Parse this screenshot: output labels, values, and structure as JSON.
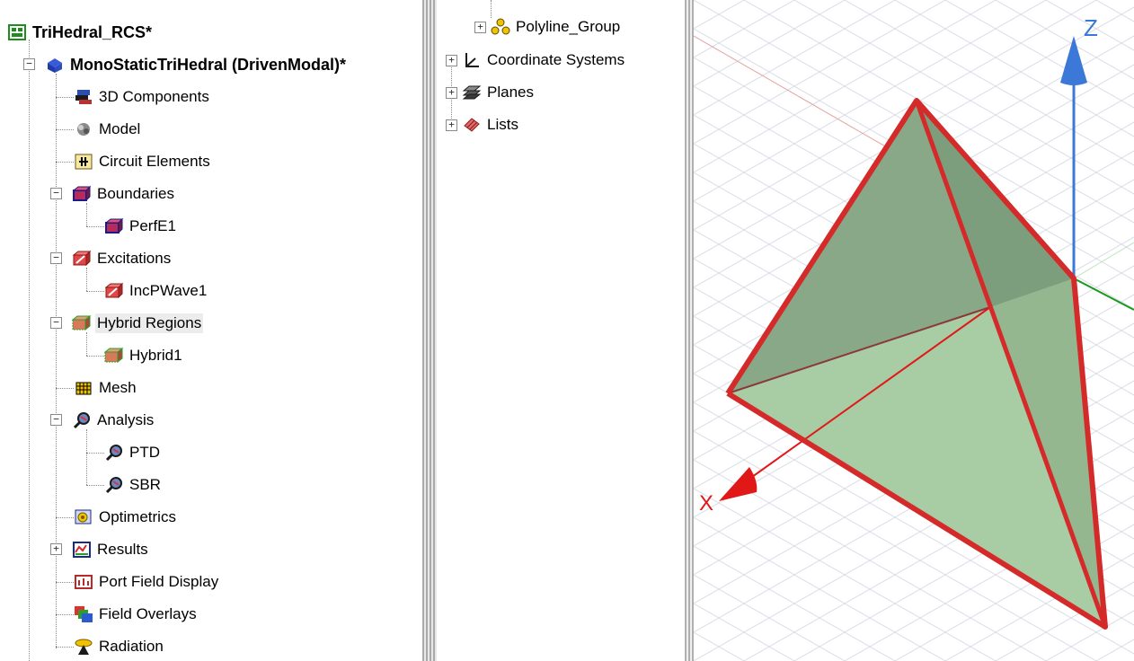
{
  "project_tree": {
    "project": "TriHedral_RCS*",
    "design": "MonoStaticTriHedral (DrivenModal)*",
    "items": [
      {
        "label": "3D Components"
      },
      {
        "label": "Model"
      },
      {
        "label": "Circuit Elements"
      },
      {
        "label": "Boundaries",
        "children": [
          "PerfE1"
        ]
      },
      {
        "label": "Excitations",
        "children": [
          "IncPWave1"
        ]
      },
      {
        "label": "Hybrid Regions",
        "children": [
          "Hybrid1"
        ]
      },
      {
        "label": "Mesh"
      },
      {
        "label": "Analysis",
        "children": [
          "PTD",
          "SBR"
        ]
      },
      {
        "label": "Optimetrics"
      },
      {
        "label": "Results"
      },
      {
        "label": "Port Field Display"
      },
      {
        "label": "Field Overlays"
      },
      {
        "label": "Radiation"
      }
    ]
  },
  "model_tree": {
    "items": [
      "Polyline_Group",
      "Coordinate Systems",
      "Planes",
      "Lists"
    ]
  },
  "viewport": {
    "axis_z": "Z",
    "axis_x": "X",
    "colors": {
      "face_dark": "#88a888",
      "face_light": "#a8cca4",
      "edge": "#d42a2a",
      "z_axis": "#3c78d8",
      "x_axis": "#e01818",
      "y_axis": "#1a9a1a",
      "grid": "#d9dde6"
    }
  }
}
